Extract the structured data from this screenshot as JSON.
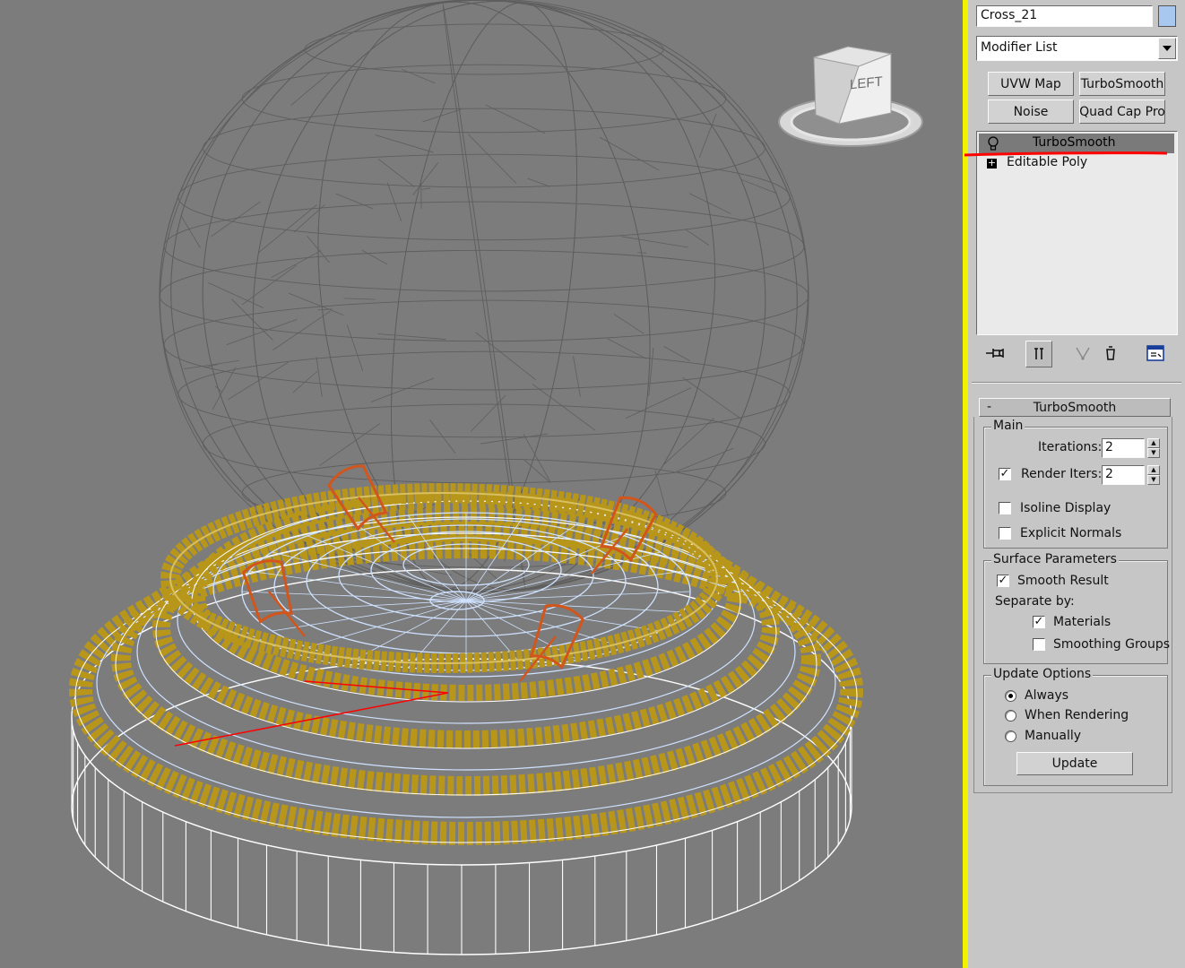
{
  "object_name": "Cross_21",
  "object_color": "#a8c8f0",
  "modifier_list": {
    "selected": "Modifier List"
  },
  "modifier_buttons": [
    "UVW Map",
    "TurboSmooth",
    "Noise",
    "Quad Cap Pro"
  ],
  "stack": [
    {
      "label": "TurboSmooth",
      "icon": "lightbulb-icon",
      "selected": true
    },
    {
      "label": "Editable Poly",
      "icon": "plus-expand-icon",
      "selected": false
    }
  ],
  "stack_toolbar": [
    "pin-stack-icon",
    "show-end-result-icon",
    "make-unique-icon",
    "remove-modifier-icon",
    "configure-modifier-sets-icon"
  ],
  "viewcube": {
    "face_label": "LEFT"
  },
  "rollout": {
    "collapse": "-",
    "title": "TurboSmooth",
    "main": {
      "legend": "Main",
      "iterations_label": "Iterations:",
      "iterations_value": "2",
      "render_iters_label": "Render Iters:",
      "render_iters_value": "2",
      "render_iters_checked": true,
      "isoline_label": "Isoline Display",
      "isoline_checked": false,
      "explicit_label": "Explicit Normals",
      "explicit_checked": false
    },
    "surface": {
      "legend": "Surface Parameters",
      "smooth_label": "Smooth Result",
      "smooth_checked": true,
      "separate_label": "Separate by:",
      "materials_label": "Materials",
      "materials_checked": true,
      "groups_label": "Smoothing Groups",
      "groups_checked": false
    },
    "update": {
      "legend": "Update Options",
      "always": "Always",
      "when_rendering": "When Rendering",
      "manually": "Manually",
      "selected": "Always",
      "update_button": "Update"
    }
  },
  "colors": {
    "viewport_bg": "#7c7c7c",
    "panel_bg": "#c6c6c6",
    "active_viewport_border": "#f2f200",
    "sphere_wire": "#5e5e5e",
    "base_wire": "#ffffff",
    "gold_mesh": "#b8961a",
    "light_blue_wire": "#cfe2ff",
    "orange_rings": "#d2561c",
    "annotation_line": "#ff0000"
  }
}
